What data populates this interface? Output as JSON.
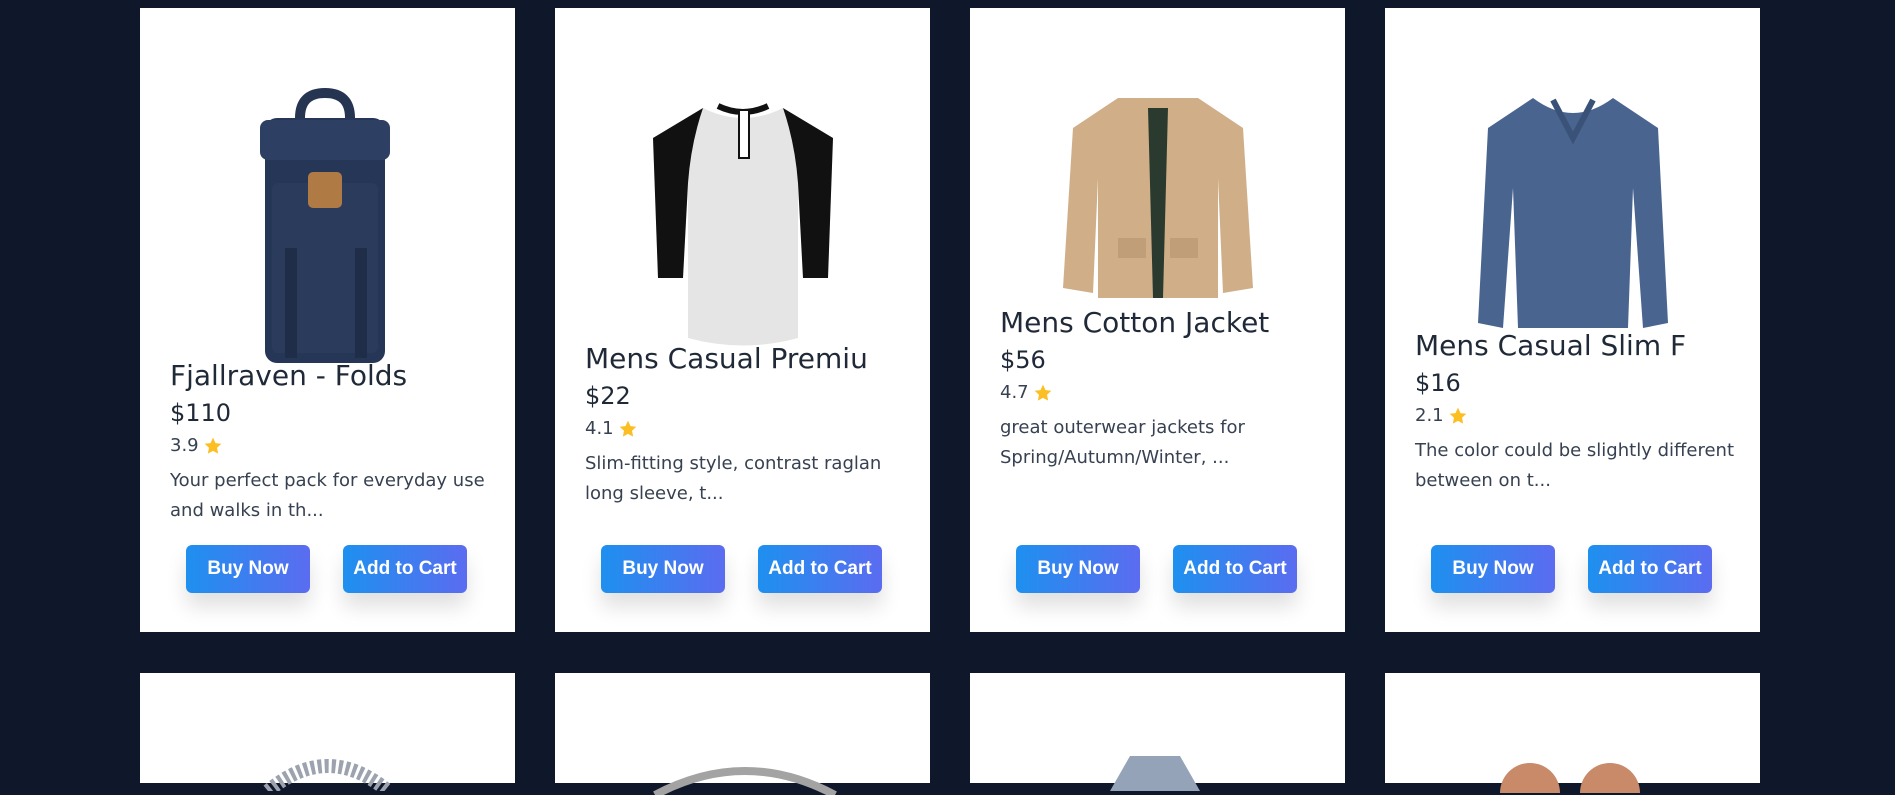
{
  "products": [
    {
      "title": "Fjallraven - Folds",
      "price": "$110",
      "rating": "3.9",
      "description": "Your perfect pack for everyday use and walks in th...",
      "image": "backpack-image"
    },
    {
      "title": "Mens Casual Premiu",
      "price": "$22",
      "rating": "4.1",
      "description": "Slim-fitting style, contrast raglan long sleeve, t...",
      "image": "raglan-tshirt-image"
    },
    {
      "title": "Mens Cotton Jacket",
      "price": "$56",
      "rating": "4.7",
      "description": "great outerwear jackets for Spring/Autumn/Winter, ...",
      "image": "cotton-jacket-image"
    },
    {
      "title": "Mens Casual Slim F",
      "price": "$16",
      "rating": "2.1",
      "description": "The color could be slightly different between on t...",
      "image": "slim-fit-shirt-image"
    }
  ],
  "buttons": {
    "buy_now": "Buy Now",
    "add_to_cart": "Add to Cart"
  },
  "icons": {
    "rating": "star-icon"
  },
  "colors": {
    "background": "#0f172a",
    "button_start": "#1e90ef",
    "button_end": "#5b6cf0",
    "star": "#fbbf24"
  }
}
